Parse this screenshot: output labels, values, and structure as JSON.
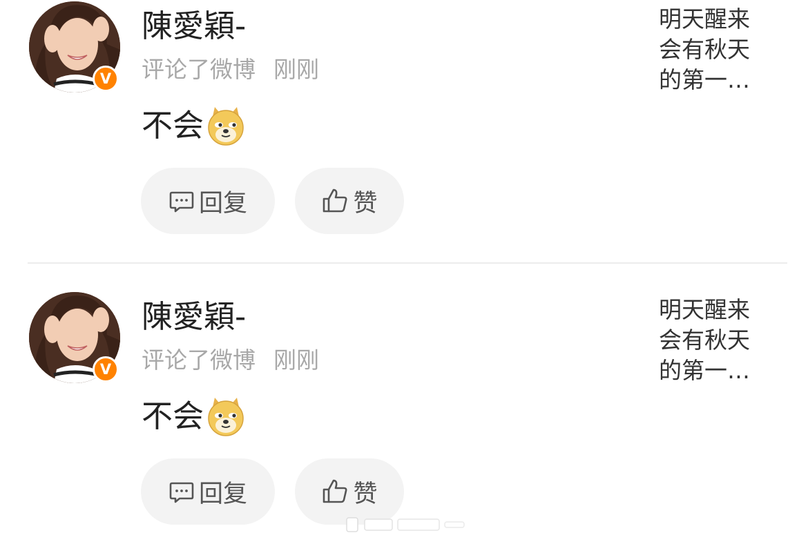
{
  "notifications": [
    {
      "username": "陳愛穎-",
      "action": "评论了微博",
      "time": "刚刚",
      "comment": "不会",
      "emoji": "doge-emoji",
      "reply_label": "回复",
      "like_label": "赞",
      "preview": [
        "明天醒来",
        "会有秋天",
        "的第一…"
      ],
      "verified": "V"
    },
    {
      "username": "陳愛穎-",
      "action": "评论了微博",
      "time": "刚刚",
      "comment": "不会",
      "emoji": "doge-emoji",
      "reply_label": "回复",
      "like_label": "赞",
      "preview": [
        "明天醒来",
        "会有秋天",
        "的第一…"
      ],
      "verified": "V"
    }
  ],
  "colors": {
    "verified_badge": "#ff8200",
    "meta_text": "#a8a8a8",
    "pill_bg": "#f3f3f3",
    "divider": "#ececec"
  }
}
